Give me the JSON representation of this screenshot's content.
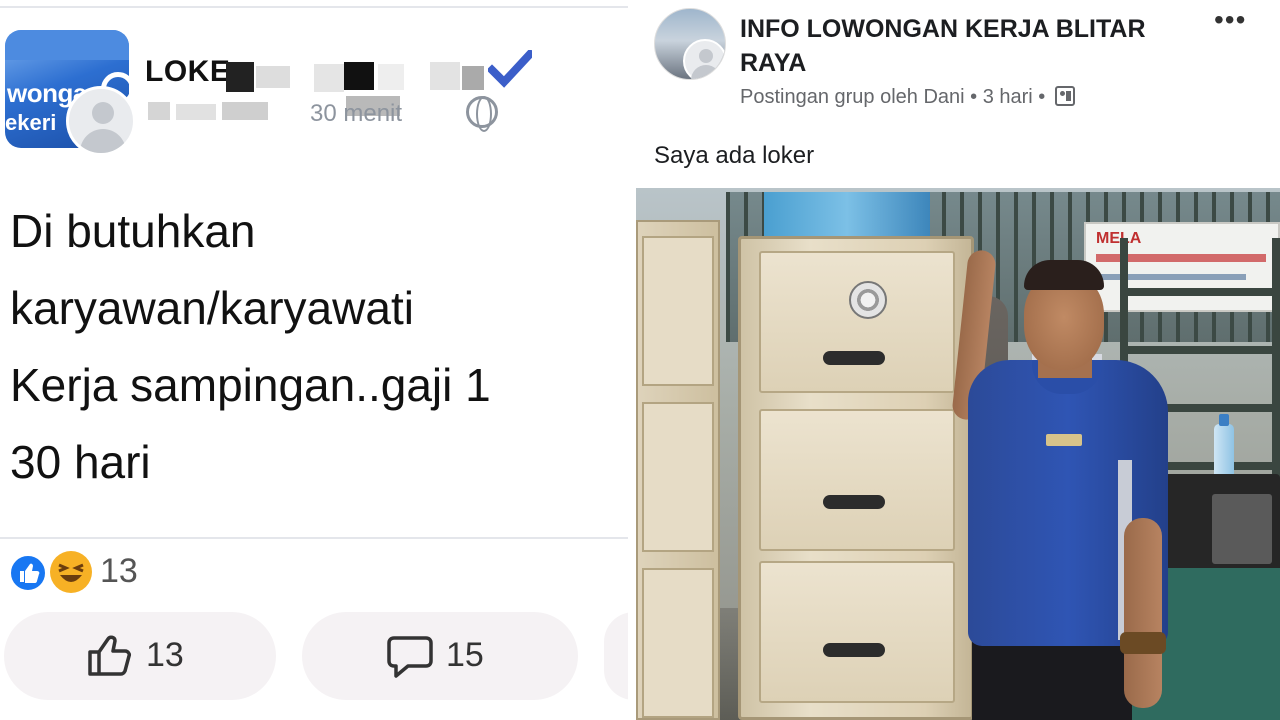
{
  "left_post": {
    "page_name": "LOKE",
    "time_text": "30 menit",
    "body_lines": [
      "Di butuhkan",
      "karyawan/karyawati",
      "Kerja sampingan..gaji 1",
      "30 hari"
    ],
    "avatar_sign_line1": "wongan",
    "avatar_sign_line2": "ekeri",
    "reactions_count": "13",
    "like_count": "13",
    "comment_count": "15",
    "icons": [
      "profile-avatar",
      "globe-icon",
      "verified-badge",
      "like-reaction",
      "haha-reaction",
      "thumbs-up-icon",
      "comment-bubble-icon"
    ]
  },
  "right_post": {
    "group_name": "INFO LOWONGAN KERJA BLITAR RAYA",
    "meta_text": "Postingan grup oleh Dani • 3 hari •",
    "caption": "Saya ada loker",
    "more_label": "•••",
    "photo_banner_text": "MELA",
    "icons": [
      "group-avatar",
      "group-icon",
      "more-options-icon"
    ]
  },
  "colors": {
    "fb_blue": "#1877f2",
    "haha_yellow": "#f7b125",
    "meta_gray": "#65676b",
    "text_dark": "#1c1e21",
    "button_bg": "#f5f2f4"
  }
}
